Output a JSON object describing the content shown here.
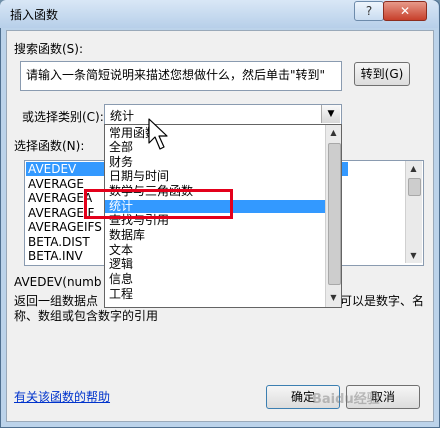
{
  "window": {
    "title": "插入函数",
    "help_symbol": "?",
    "close_symbol": "✕"
  },
  "search": {
    "label": "搜索函数(S):",
    "text": "请输入一条简短说明来描述您想做什么，然后单击\"转到\"",
    "go_button": "转到(G)"
  },
  "category": {
    "label": "或选择类别(C):",
    "selected": "统计",
    "options": [
      "常用函数",
      "全部",
      "财务",
      "日期与时间",
      "数学与三角函数",
      "统计",
      "查找与引用",
      "数据库",
      "文本",
      "逻辑",
      "信息",
      "工程"
    ],
    "selected_index": 5
  },
  "functions": {
    "label": "选择函数(N):",
    "items": [
      "AVEDEV",
      "AVERAGE",
      "AVERAGEA",
      "AVERAGEIF",
      "AVERAGEIFS",
      "BETA.DIST",
      "BETA.INV"
    ],
    "selected_index": 0
  },
  "description": {
    "signature": "AVEDEV(numb",
    "line1_left": "返回一组数据点",
    "line1_right": "可以是数字、名",
    "line2": "称、数组或包含数字的引用"
  },
  "footer": {
    "help_link": "有关该函数的帮助",
    "ok_button": "确定",
    "cancel_button": "取消"
  },
  "watermark": "Baidu经验",
  "colors": {
    "selection": "#3399ff",
    "highlight_box": "#e3001b",
    "link": "#0033cc"
  },
  "icons": [
    "cursor-arrow-icon",
    "dropdown-arrow-icon",
    "scroll-up-icon",
    "scroll-down-icon"
  ]
}
